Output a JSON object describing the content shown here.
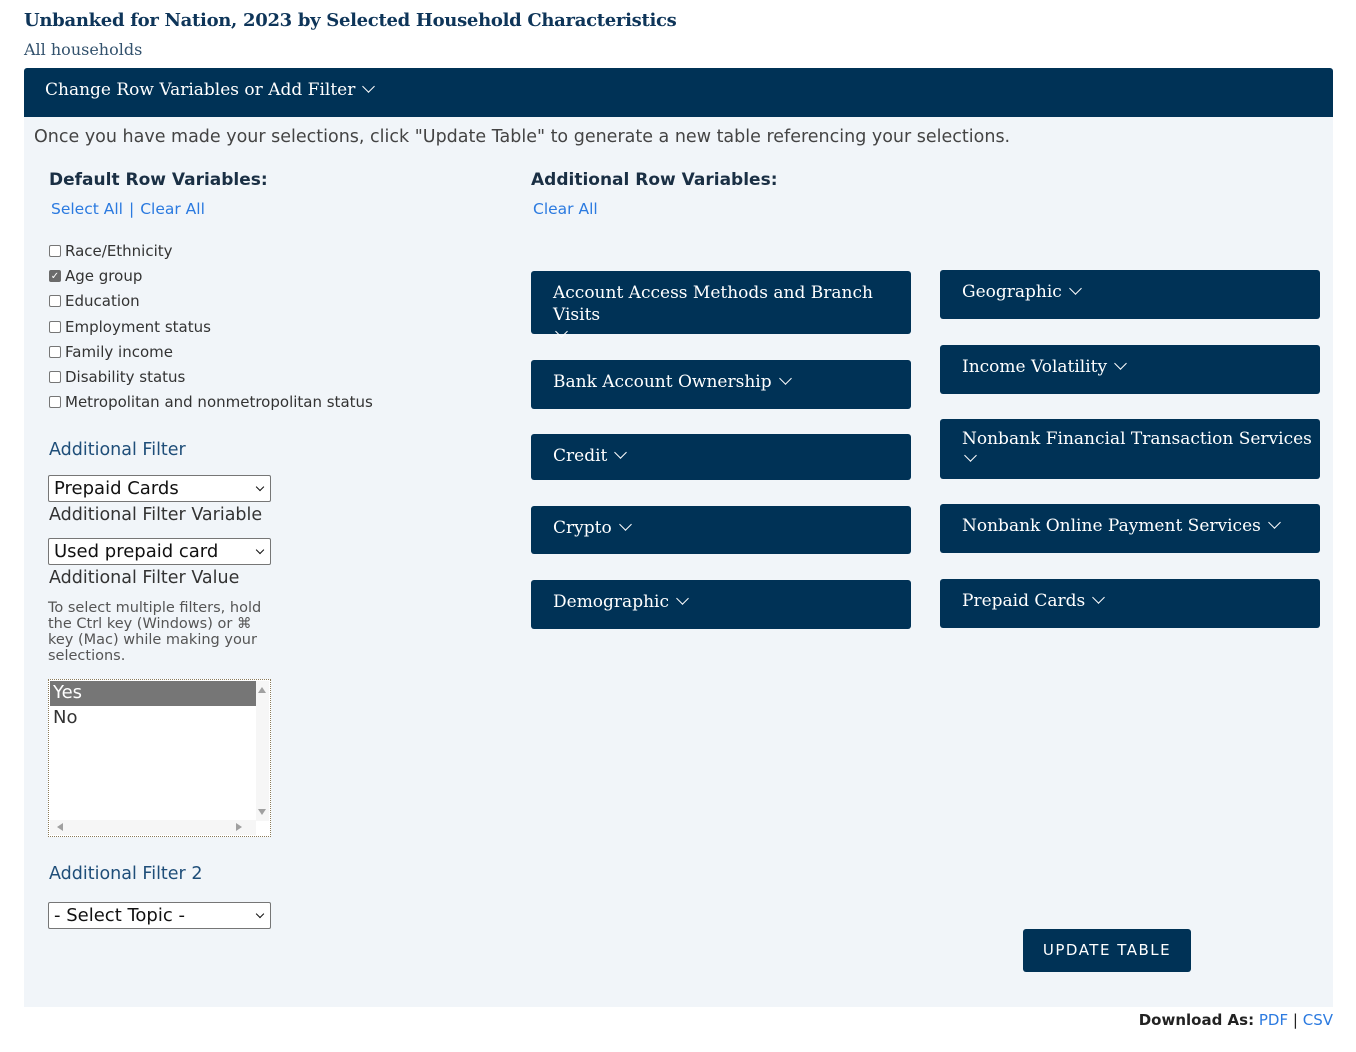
{
  "header": {
    "title": "Unbanked for Nation, 2023 by Selected Household Characteristics",
    "subtitle": "All households"
  },
  "panel": {
    "toggle_label": "Change Row Variables or Add Filter",
    "intro": "Once you have made your selections, click \"Update Table\" to generate a new table referencing your selections."
  },
  "default_rows": {
    "heading": "Default Row Variables:",
    "select_all": "Select All",
    "separator": "|",
    "clear_all": "Clear All",
    "items": [
      {
        "label": "Race/Ethnicity",
        "checked": false
      },
      {
        "label": "Age group",
        "checked": true
      },
      {
        "label": "Education",
        "checked": false
      },
      {
        "label": "Employment status",
        "checked": false
      },
      {
        "label": "Family income",
        "checked": false
      },
      {
        "label": "Disability status",
        "checked": false
      },
      {
        "label": "Metropolitan and nonmetropolitan status",
        "checked": false
      }
    ]
  },
  "filter": {
    "heading": "Additional Filter",
    "topic_value": "Prepaid Cards",
    "variable_label": "Additional Filter Variable",
    "variable_value": "Used prepaid card",
    "value_label": "Additional Filter Value",
    "hint": "To select multiple filters, hold the Ctrl key (Windows) or ⌘ key (Mac) while making your selections.",
    "options": [
      {
        "label": "Yes",
        "selected": true
      },
      {
        "label": "No",
        "selected": false
      }
    ],
    "filter2_heading": "Additional Filter 2",
    "filter2_value": "- Select Topic -"
  },
  "additional_rows": {
    "heading": "Additional Row Variables:",
    "clear_all": "Clear All",
    "left_column": [
      "Account Access Methods and Branch Visits",
      "Bank Account Ownership",
      "Credit",
      "Crypto",
      "Demographic"
    ],
    "right_column": [
      "Geographic",
      "Income Volatility",
      "Nonbank Financial Transaction Services",
      "Nonbank Online Payment Services",
      "Prepaid Cards"
    ]
  },
  "actions": {
    "update_label": "UPDATE TABLE"
  },
  "download": {
    "label": "Download As:",
    "pdf": "PDF",
    "separator": "|",
    "csv": "CSV"
  },
  "colors": {
    "navy": "#003256",
    "link": "#2b7ae0",
    "panel_bg": "#f1f5f9"
  }
}
